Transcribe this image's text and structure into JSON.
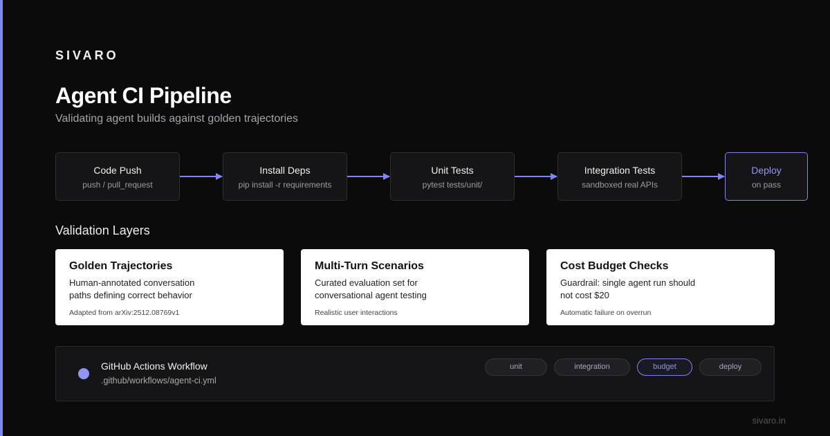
{
  "brand": "SIVARO",
  "title": "Agent CI Pipeline",
  "subtitle": "Validating agent builds against golden trajectories",
  "pipeline": {
    "stages": [
      {
        "title": "Code Push",
        "subtitle": "push / pull_request"
      },
      {
        "title": "Install Deps",
        "subtitle": "pip install -r requirements"
      },
      {
        "title": "Unit Tests",
        "subtitle": "pytest tests/unit/"
      },
      {
        "title": "Integration Tests",
        "subtitle": "sandboxed real APIs"
      },
      {
        "title": "Deploy",
        "subtitle": "on pass"
      }
    ],
    "active_stage": "Deploy"
  },
  "section_title": "Validation Layers",
  "cards": [
    {
      "title": "Golden Trajectories",
      "description": "Human-annotated conversation paths defining correct behavior",
      "footnote": "Adapted from arXiv:2512.08769v1"
    },
    {
      "title": "Multi-Turn Scenarios",
      "description": "Curated evaluation set for conversational agent testing",
      "footnote": "Realistic user interactions"
    },
    {
      "title": "Cost Budget Checks",
      "description": "Guardrail: single agent run should not cost $20",
      "footnote": "Automatic failure on overrun"
    }
  ],
  "workflow": {
    "name": "GitHub Actions Workflow",
    "path": ".github/workflows/agent-ci.yml",
    "tags": [
      "unit",
      "integration",
      "budget",
      "deploy"
    ],
    "active_tag": "budget"
  },
  "footer_url": "sivaro.in",
  "colors": {
    "accent": "#7f88f2",
    "background": "#0b0b0c",
    "card": "#ffffff"
  }
}
